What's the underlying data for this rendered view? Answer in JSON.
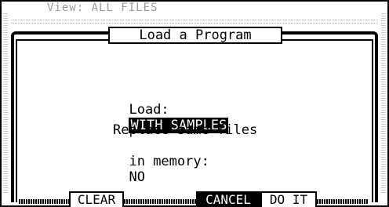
{
  "header": {
    "view_label": "View: ALL FILES"
  },
  "dialog": {
    "title": "Load a Program",
    "load_label": "Load:",
    "load_value": "WITH SAMPLES",
    "replace_line1": "Replace same files",
    "replace_line2_label": "in memory:",
    "replace_value": "NO"
  },
  "softkeys": {
    "clear": "CLEAR",
    "cancel": "CANCEL",
    "do_it": "DO IT"
  }
}
